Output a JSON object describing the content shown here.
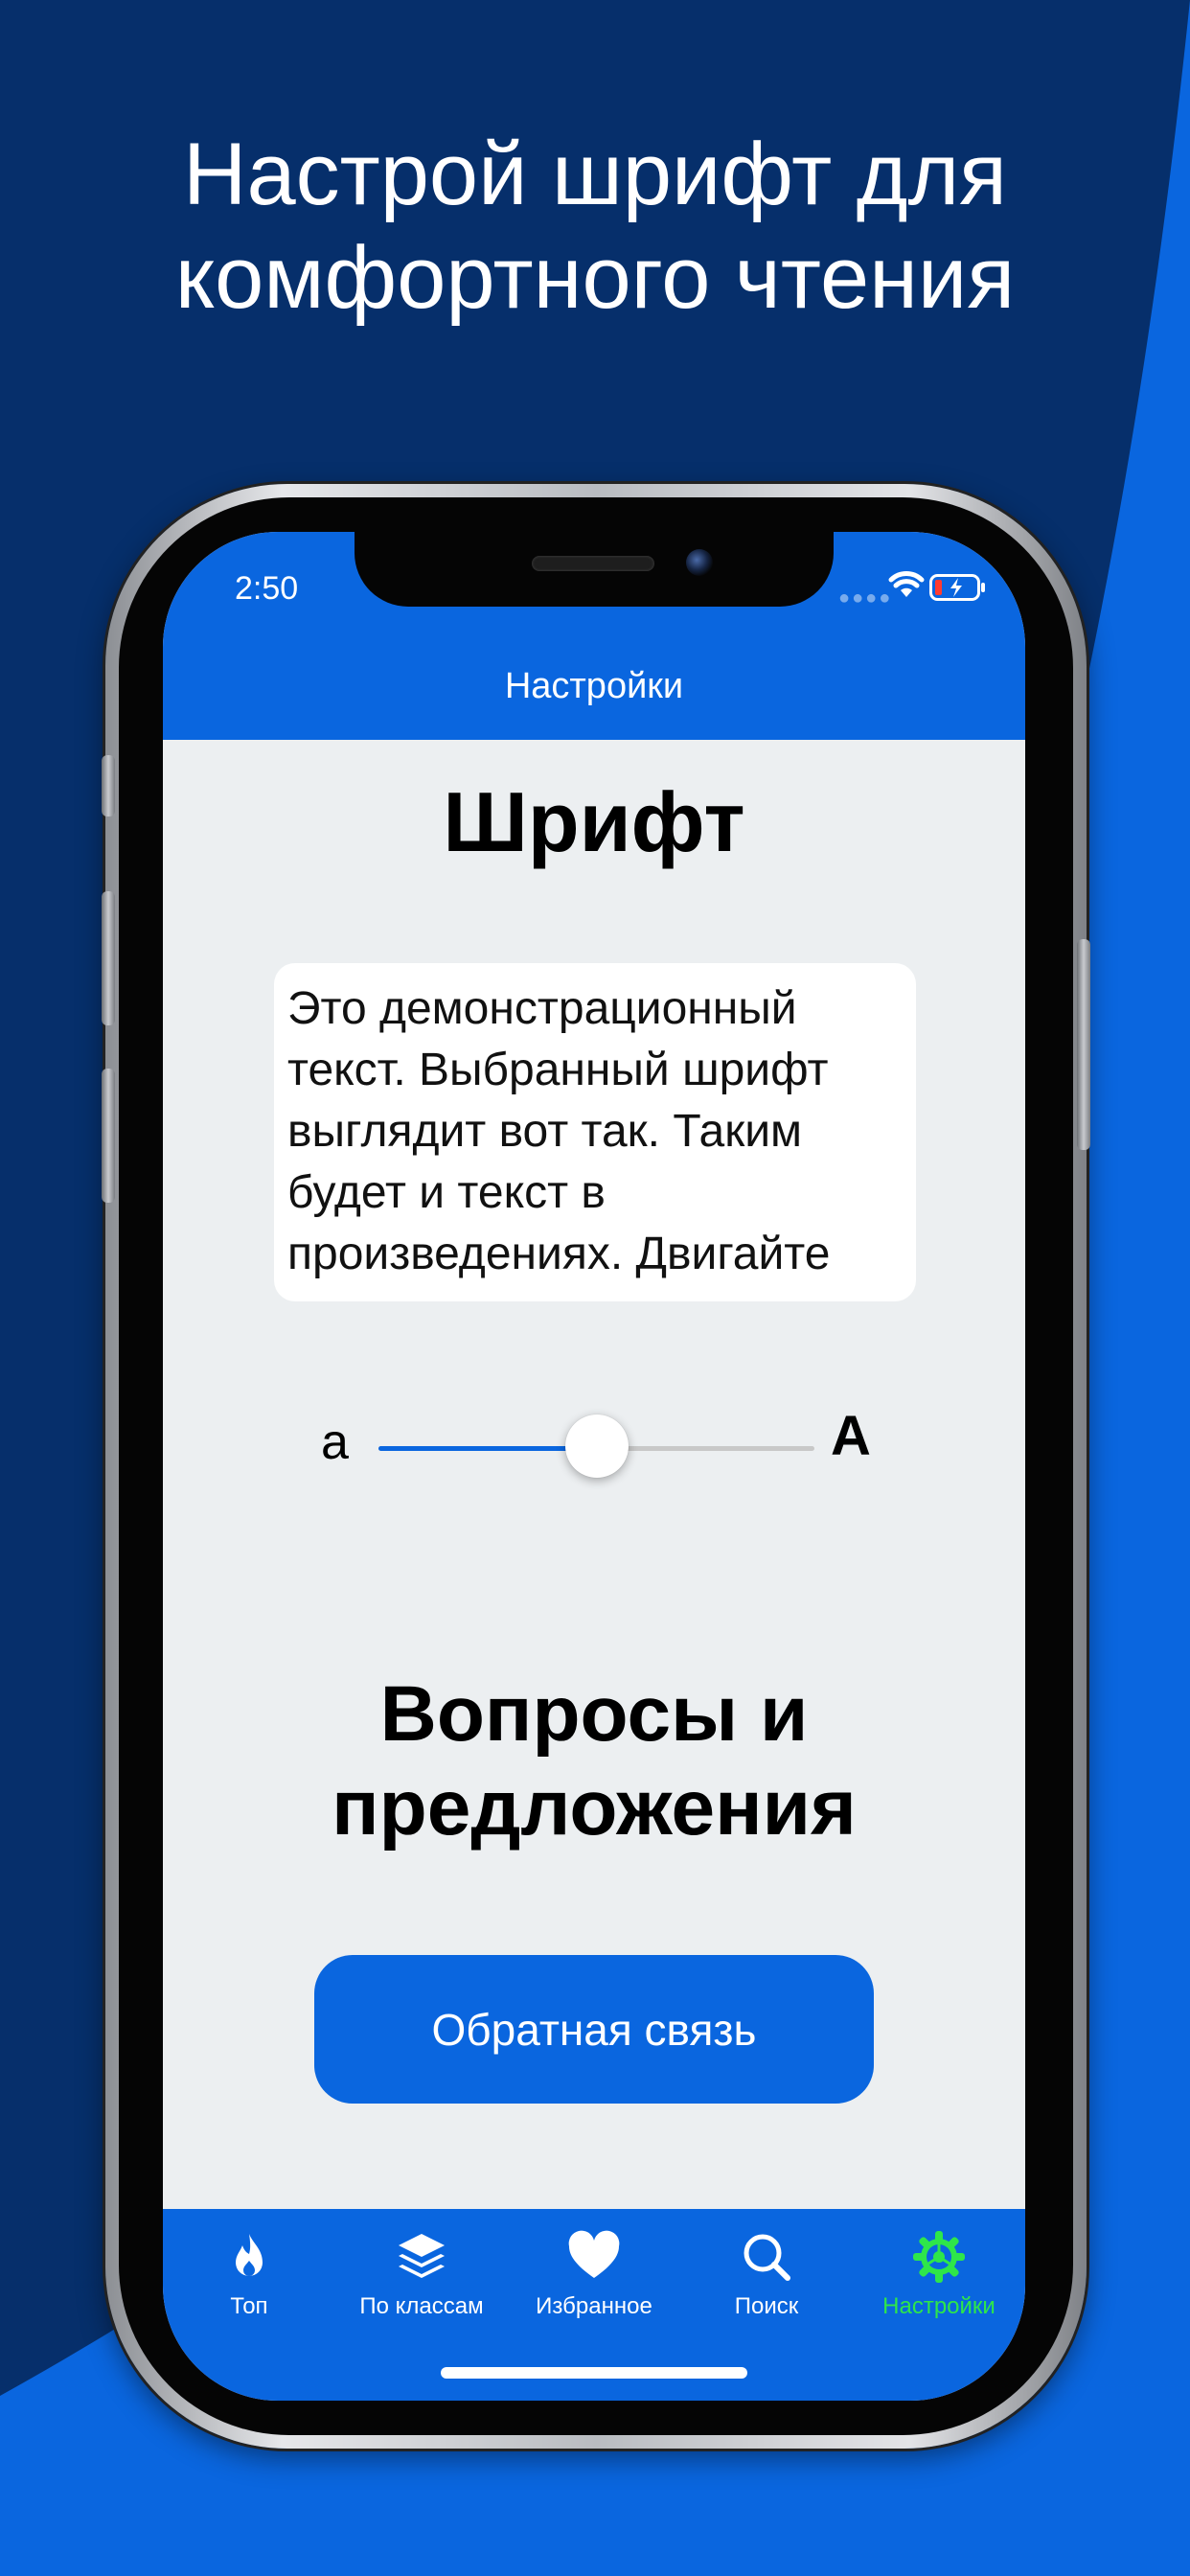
{
  "promo": {
    "headline_line1": "Настрой шрифт для",
    "headline_line2": "комфортного чтения"
  },
  "status_bar": {
    "time": "2:50"
  },
  "nav": {
    "title": "Настройки"
  },
  "font_section": {
    "title": "Шрифт",
    "demo_text": "Это демонстрационный текст. Выбранный шрифт выглядит вот так. Таким будет и текст в произведениях. Двигайте",
    "slider": {
      "min_label": "а",
      "max_label": "А",
      "value_fraction": 0.5
    }
  },
  "feedback_section": {
    "title_line1": "Вопросы и",
    "title_line2": "предложения",
    "button_label": "Обратная связь"
  },
  "tabbar": {
    "items": [
      {
        "label": "Топ",
        "icon": "flame-icon",
        "active": false
      },
      {
        "label": "По классам",
        "icon": "layers-icon",
        "active": false
      },
      {
        "label": "Избранное",
        "icon": "heart-icon",
        "active": false
      },
      {
        "label": "Поиск",
        "icon": "search-icon",
        "active": false
      },
      {
        "label": "Настройки",
        "icon": "gear-icon",
        "active": true
      }
    ]
  },
  "colors": {
    "background_dark": "#062f6b",
    "background_blue": "#0a66df",
    "accent_active": "#2ee64a",
    "screen_bg": "#eceff1"
  }
}
